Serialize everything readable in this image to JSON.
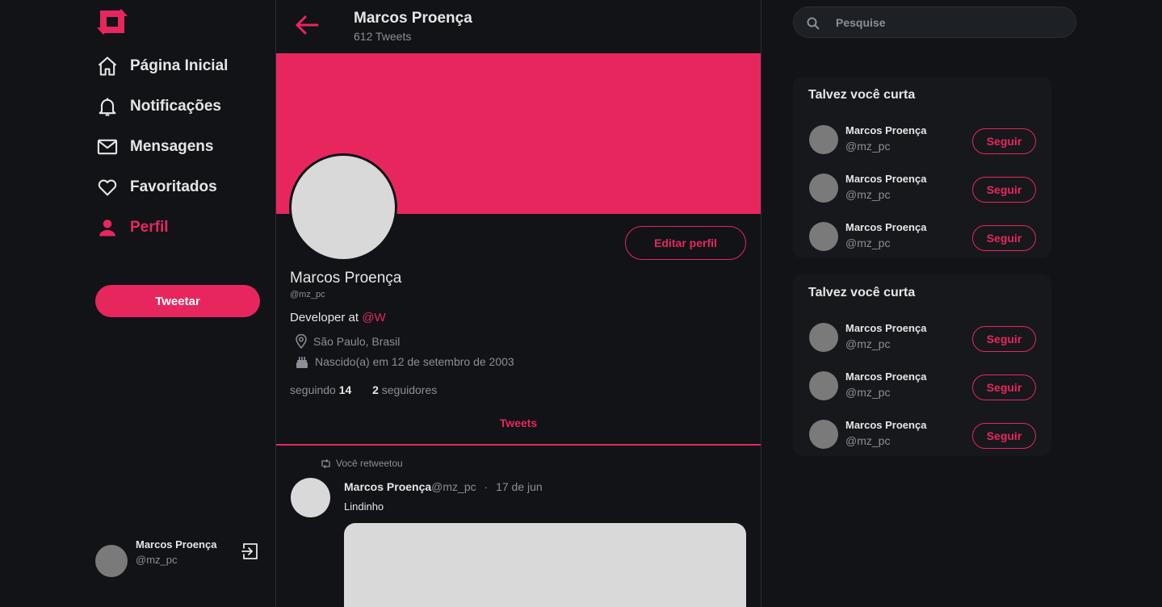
{
  "nav": {
    "items": [
      {
        "label": "Página Inicial",
        "icon": "home-icon"
      },
      {
        "label": "Notificações",
        "icon": "bell-icon"
      },
      {
        "label": "Mensagens",
        "icon": "mail-icon"
      },
      {
        "label": "Favoritados",
        "icon": "heart-icon"
      },
      {
        "label": "Perfil",
        "icon": "user-icon",
        "active": true
      }
    ],
    "tweet_button": "Tweetar"
  },
  "current_user": {
    "name": "Marcos Proença",
    "handle": "@mz_pc"
  },
  "header": {
    "name": "Marcos Proença",
    "tweet_count": "612 Tweets"
  },
  "profile": {
    "name": "Marcos Proença",
    "handle": "@mz_pc",
    "edit_button": "Editar perfil",
    "bio_text": "Developer at ",
    "bio_mention": "@W",
    "location": "São Paulo, Brasil",
    "birth": "Nascido(a) em 12 de setembro de 2003",
    "following_label": "seguindo",
    "following_count": "14",
    "followers_count": "2",
    "followers_label": "seguidores"
  },
  "tabs": {
    "tweets": "Tweets"
  },
  "tweet": {
    "retweet_label": "Você retweetou",
    "author": "Marcos Proença",
    "handle": "@mz_pc",
    "separator": "·",
    "date": "17 de jun",
    "text": "Lindinho"
  },
  "search": {
    "placeholder": "Pesquise"
  },
  "suggestion_cards": [
    {
      "title": "Talvez você curta",
      "users": [
        {
          "name": "Marcos Proença",
          "handle": "@mz_pc",
          "button": "Seguir"
        },
        {
          "name": "Marcos Proença",
          "handle": "@mz_pc",
          "button": "Seguir"
        },
        {
          "name": "Marcos Proença",
          "handle": "@mz_pc",
          "button": "Seguir"
        }
      ]
    },
    {
      "title": "Talvez você curta",
      "users": [
        {
          "name": "Marcos Proença",
          "handle": "@mz_pc",
          "button": "Seguir"
        },
        {
          "name": "Marcos Proença",
          "handle": "@mz_pc",
          "button": "Seguir"
        },
        {
          "name": "Marcos Proença",
          "handle": "@mz_pc",
          "button": "Seguir"
        }
      ]
    }
  ],
  "colors": {
    "accent": "#e8265e",
    "background": "#111317",
    "card": "#16181c"
  }
}
